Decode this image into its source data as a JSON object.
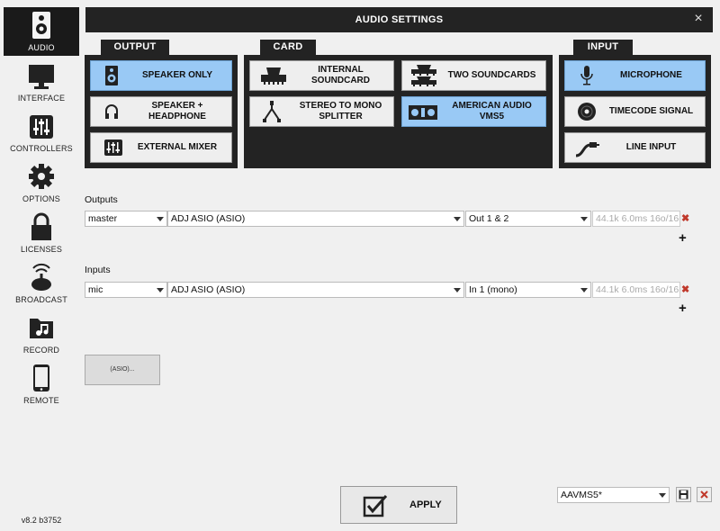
{
  "sidebar": {
    "items": [
      {
        "label": "AUDIO",
        "icon": "speaker-icon",
        "active": true
      },
      {
        "label": "INTERFACE",
        "icon": "monitor-icon"
      },
      {
        "label": "CONTROLLERS",
        "icon": "sliders-icon"
      },
      {
        "label": "OPTIONS",
        "icon": "gear-icon"
      },
      {
        "label": "LICENSES",
        "icon": "lock-icon"
      },
      {
        "label": "BROADCAST",
        "icon": "broadcast-icon"
      },
      {
        "label": "RECORD",
        "icon": "music-folder-icon"
      },
      {
        "label": "REMOTE",
        "icon": "tablet-icon"
      }
    ],
    "version": "v8.2 b3752"
  },
  "window": {
    "title": "AUDIO SETTINGS",
    "close_label": "×"
  },
  "output_panel": {
    "title": "OUTPUT",
    "buttons": [
      {
        "label": "SPEAKER ONLY",
        "icon": "speaker-icon",
        "selected": true
      },
      {
        "label": "SPEAKER + HEADPHONE",
        "icon": "headphone-icon",
        "selected": false
      },
      {
        "label": "EXTERNAL MIXER",
        "icon": "mixer-icon",
        "selected": false
      }
    ]
  },
  "card_panel": {
    "title": "CARD",
    "buttons": [
      {
        "label": "INTERNAL SOUNDCARD",
        "icon": "internal-soundcard-icon",
        "selected": false
      },
      {
        "label": "TWO SOUNDCARDS",
        "icon": "two-soundcards-icon",
        "selected": false
      },
      {
        "label": "STEREO TO MONO SPLITTER",
        "icon": "splitter-cable-icon",
        "selected": false
      },
      {
        "label": "AMERICAN AUDIO VMS5",
        "icon": "controller-icon",
        "selected": true
      }
    ]
  },
  "input_panel": {
    "title": "INPUT",
    "buttons": [
      {
        "label": "MICROPHONE",
        "icon": "microphone-icon",
        "selected": true
      },
      {
        "label": "TIMECODE SIGNAL",
        "icon": "vinyl-icon",
        "selected": false
      },
      {
        "label": "LINE INPUT",
        "icon": "line-cable-icon",
        "selected": false
      }
    ]
  },
  "outputs": {
    "label": "Outputs",
    "rows": [
      {
        "channel": "master",
        "device": "ADJ ASIO (ASIO)",
        "port": "Out 1 & 2",
        "info": "44.1k 6.0ms 16o/16i"
      }
    ]
  },
  "inputs": {
    "label": "Inputs",
    "rows": [
      {
        "channel": "mic",
        "device": "ADJ ASIO (ASIO)",
        "port": "In 1 (mono)",
        "info": "44.1k 6.0ms 16o/16i"
      }
    ]
  },
  "asio_button": {
    "label": "(ASIO)..."
  },
  "apply_button": {
    "label": "APPLY",
    "icon": "checkbox-icon"
  },
  "preset": {
    "value": "AAVMS5*",
    "save_icon": "save-icon",
    "delete_icon": "delete-icon"
  },
  "colors": {
    "selected": "#99c9f5",
    "panel": "#232323",
    "remove": "#c0392b"
  }
}
